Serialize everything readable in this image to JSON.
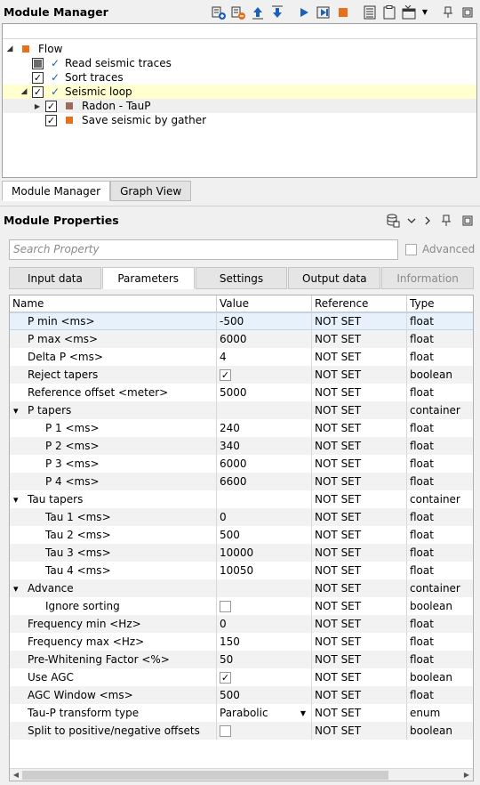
{
  "module_manager": {
    "title": "Module Manager",
    "toolbar_icons": [
      "add-module-icon",
      "remove-module-icon",
      "move-up-icon",
      "move-down-icon",
      "run-icon",
      "run-step-icon",
      "stop-icon",
      "list-icon",
      "clipboard-icon",
      "window-icon",
      "chevron-down-icon",
      "pin-icon",
      "restore-icon"
    ],
    "tree": [
      {
        "label": "Flow",
        "depth": 0,
        "expander": "collapse",
        "marker": "orange-square"
      },
      {
        "label": "Read seismic traces",
        "depth": 1,
        "state": "partial",
        "check": "blue"
      },
      {
        "label": "Sort traces",
        "depth": 1,
        "state": "checked",
        "check": "blue"
      },
      {
        "label": "Seismic loop",
        "depth": 1,
        "state": "checked",
        "check": "blue",
        "expander": "collapse",
        "highlight": true
      },
      {
        "label": "Radon - TauP",
        "depth": 2,
        "state": "checked",
        "marker": "brown-square",
        "expander": "expand"
      },
      {
        "label": "Save seismic by gather",
        "depth": 2,
        "state": "checked",
        "marker": "orange-square"
      }
    ],
    "tabs": [
      {
        "label": "Module Manager",
        "active": true
      },
      {
        "label": "Graph View",
        "active": false
      }
    ]
  },
  "module_properties": {
    "title": "Module Properties",
    "search_placeholder": "Search Property",
    "advanced_label": "Advanced",
    "tabs": [
      {
        "label": "Input data",
        "active": false
      },
      {
        "label": "Parameters",
        "active": true
      },
      {
        "label": "Settings",
        "active": false
      },
      {
        "label": "Output data",
        "active": false
      },
      {
        "label": "Information",
        "active": false,
        "disabled": true
      }
    ],
    "columns": [
      "Name",
      "Value",
      "Reference",
      "Type"
    ],
    "rows": [
      {
        "name": "P min <ms>",
        "value": "-500",
        "reference": "NOT SET",
        "type": "float",
        "depth": 1
      },
      {
        "name": "P max <ms>",
        "value": "6000",
        "reference": "NOT SET",
        "type": "float",
        "depth": 1
      },
      {
        "name": "Delta P <ms>",
        "value": "4",
        "reference": "NOT SET",
        "type": "float",
        "depth": 1
      },
      {
        "name": "Reject tapers",
        "value": "",
        "reference": "NOT SET",
        "type": "boolean",
        "depth": 1,
        "checkbox": true,
        "checked": true
      },
      {
        "name": "Reference offset <meter>",
        "value": "5000",
        "reference": "NOT SET",
        "type": "float",
        "depth": 1
      },
      {
        "name": "P tapers",
        "value": "",
        "reference": "NOT SET",
        "type": "container",
        "depth": 0,
        "expander": true
      },
      {
        "name": "P 1 <ms>",
        "value": "240",
        "reference": "NOT SET",
        "type": "float",
        "depth": 2
      },
      {
        "name": "P 2 <ms>",
        "value": "340",
        "reference": "NOT SET",
        "type": "float",
        "depth": 2
      },
      {
        "name": "P 3 <ms>",
        "value": "6000",
        "reference": "NOT SET",
        "type": "float",
        "depth": 2
      },
      {
        "name": "P 4 <ms>",
        "value": "6600",
        "reference": "NOT SET",
        "type": "float",
        "depth": 2
      },
      {
        "name": "Tau tapers",
        "value": "",
        "reference": "NOT SET",
        "type": "container",
        "depth": 0,
        "expander": true
      },
      {
        "name": "Tau 1 <ms>",
        "value": "0",
        "reference": "NOT SET",
        "type": "float",
        "depth": 2
      },
      {
        "name": "Tau 2 <ms>",
        "value": "500",
        "reference": "NOT SET",
        "type": "float",
        "depth": 2
      },
      {
        "name": "Tau 3 <ms>",
        "value": "10000",
        "reference": "NOT SET",
        "type": "float",
        "depth": 2
      },
      {
        "name": "Tau 4 <ms>",
        "value": "10050",
        "reference": "NOT SET",
        "type": "float",
        "depth": 2
      },
      {
        "name": "Advance",
        "value": "",
        "reference": "NOT SET",
        "type": "container",
        "depth": 0,
        "expander": true
      },
      {
        "name": "Ignore sorting",
        "value": "",
        "reference": "NOT SET",
        "type": "boolean",
        "depth": 2,
        "checkbox": true,
        "checked": false
      },
      {
        "name": "Frequency min <Hz>",
        "value": "0",
        "reference": "NOT SET",
        "type": "float",
        "depth": 1
      },
      {
        "name": "Frequency max <Hz>",
        "value": "150",
        "reference": "NOT SET",
        "type": "float",
        "depth": 1
      },
      {
        "name": "Pre-Whitening Factor <%>",
        "value": "50",
        "reference": "NOT SET",
        "type": "float",
        "depth": 1
      },
      {
        "name": "Use AGC",
        "value": "",
        "reference": "NOT SET",
        "type": "boolean",
        "depth": 1,
        "checkbox": true,
        "checked": true
      },
      {
        "name": "AGC Window <ms>",
        "value": "500",
        "reference": "NOT SET",
        "type": "float",
        "depth": 1
      },
      {
        "name": "Tau-P transform type",
        "value": "Parabolic",
        "reference": "NOT SET",
        "type": "enum",
        "depth": 1,
        "dropdown": true
      },
      {
        "name": "Split to positive/negative offsets",
        "value": "",
        "reference": "NOT SET",
        "type": "boolean",
        "depth": 1,
        "checkbox": true,
        "checked": false
      }
    ]
  },
  "colors": {
    "accent_blue": "#1c5fb8",
    "orange": "#e8701a",
    "brown": "#9e6b5a",
    "highlight": "#ffffd0"
  }
}
